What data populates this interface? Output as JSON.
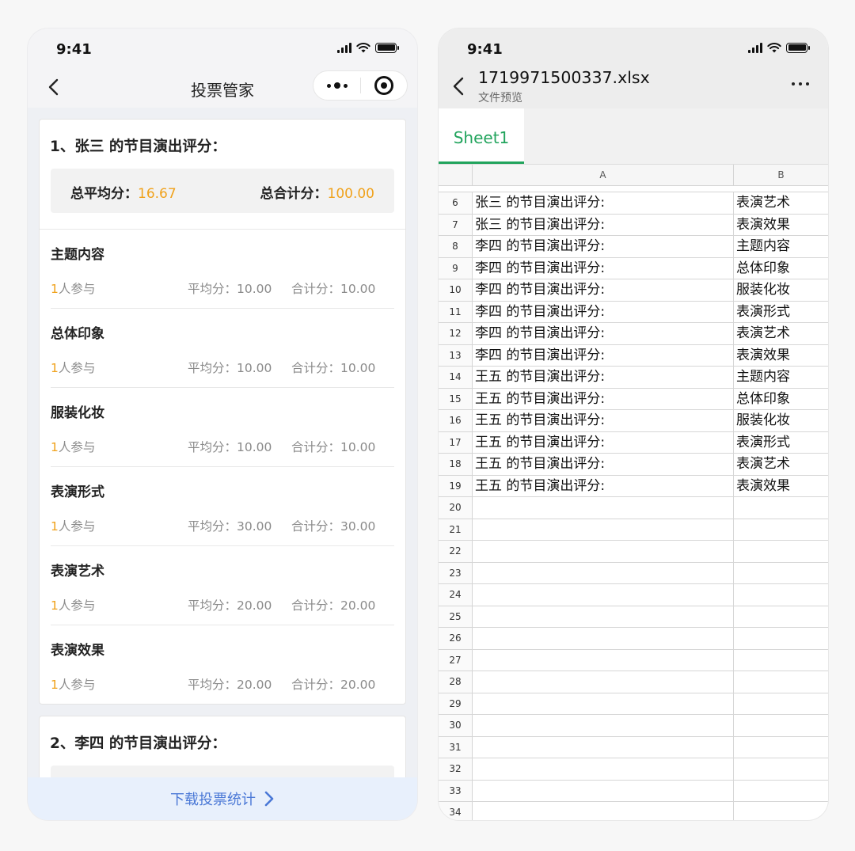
{
  "left_phone": {
    "status_time": "9:41",
    "nav_title": "投票管家",
    "cards": [
      {
        "title": "1、张三 的节目演出评分：",
        "avg_label": "总平均分：",
        "avg_value": "16.67",
        "total_label": "总合计分：",
        "total_value": "100.00",
        "items": [
          {
            "name": "主题内容",
            "count": "1",
            "count_suffix": "人参与",
            "avg": "平均分：10.00",
            "total": "合计分：10.00"
          },
          {
            "name": "总体印象",
            "count": "1",
            "count_suffix": "人参与",
            "avg": "平均分：10.00",
            "total": "合计分：10.00"
          },
          {
            "name": "服装化妆",
            "count": "1",
            "count_suffix": "人参与",
            "avg": "平均分：10.00",
            "total": "合计分：10.00"
          },
          {
            "name": "表演形式",
            "count": "1",
            "count_suffix": "人参与",
            "avg": "平均分：30.00",
            "total": "合计分：30.00"
          },
          {
            "name": "表演艺术",
            "count": "1",
            "count_suffix": "人参与",
            "avg": "平均分：20.00",
            "total": "合计分：20.00"
          },
          {
            "name": "表演效果",
            "count": "1",
            "count_suffix": "人参与",
            "avg": "平均分：20.00",
            "total": "合计分：20.00"
          }
        ]
      },
      {
        "title": "2、李四 的节目演出评分："
      }
    ],
    "download_label": "下载投票统计",
    "accent_color": "#f0a21c",
    "link_color": "#4a78d6"
  },
  "right_phone": {
    "status_time": "9:41",
    "file_name": "1719971500337.xlsx",
    "file_subtitle": "文件预览",
    "sheet_tab": "Sheet1",
    "col_a": "A",
    "col_b": "B",
    "rows": [
      {
        "n": "6",
        "a": "张三 的节目演出评分:",
        "b": "表演艺术"
      },
      {
        "n": "7",
        "a": "张三 的节目演出评分:",
        "b": "表演效果"
      },
      {
        "n": "8",
        "a": "李四 的节目演出评分:",
        "b": "主题内容"
      },
      {
        "n": "9",
        "a": "李四 的节目演出评分:",
        "b": "总体印象"
      },
      {
        "n": "10",
        "a": "李四 的节目演出评分:",
        "b": "服装化妆"
      },
      {
        "n": "11",
        "a": "李四 的节目演出评分:",
        "b": "表演形式"
      },
      {
        "n": "12",
        "a": "李四 的节目演出评分:",
        "b": "表演艺术"
      },
      {
        "n": "13",
        "a": "李四 的节目演出评分:",
        "b": "表演效果"
      },
      {
        "n": "14",
        "a": "王五 的节目演出评分:",
        "b": "主题内容"
      },
      {
        "n": "15",
        "a": "王五 的节目演出评分:",
        "b": "总体印象"
      },
      {
        "n": "16",
        "a": "王五 的节目演出评分:",
        "b": "服装化妆"
      },
      {
        "n": "17",
        "a": "王五 的节目演出评分:",
        "b": "表演形式"
      },
      {
        "n": "18",
        "a": "王五 的节目演出评分:",
        "b": "表演艺术"
      },
      {
        "n": "19",
        "a": "王五 的节目演出评分:",
        "b": "表演效果"
      },
      {
        "n": "20",
        "a": "",
        "b": ""
      },
      {
        "n": "21",
        "a": "",
        "b": ""
      },
      {
        "n": "22",
        "a": "",
        "b": ""
      },
      {
        "n": "23",
        "a": "",
        "b": ""
      },
      {
        "n": "24",
        "a": "",
        "b": ""
      },
      {
        "n": "25",
        "a": "",
        "b": ""
      },
      {
        "n": "26",
        "a": "",
        "b": ""
      },
      {
        "n": "27",
        "a": "",
        "b": ""
      },
      {
        "n": "28",
        "a": "",
        "b": ""
      },
      {
        "n": "29",
        "a": "",
        "b": ""
      },
      {
        "n": "30",
        "a": "",
        "b": ""
      },
      {
        "n": "31",
        "a": "",
        "b": ""
      },
      {
        "n": "32",
        "a": "",
        "b": ""
      },
      {
        "n": "33",
        "a": "",
        "b": ""
      },
      {
        "n": "34",
        "a": "",
        "b": ""
      }
    ],
    "tab_color": "#22a45d"
  },
  "icons": [
    "back-chevron-icon",
    "more-dots-icon",
    "close-target-icon",
    "cellular-signal-icon",
    "wifi-icon",
    "battery-icon",
    "chevron-right-icon"
  ]
}
